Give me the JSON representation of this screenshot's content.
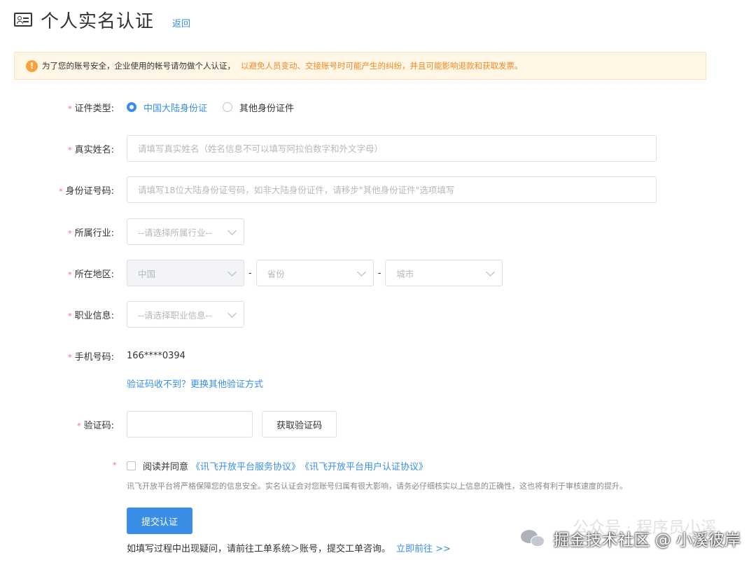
{
  "header": {
    "title": "个人实名认证",
    "back_label": "返回"
  },
  "alert": {
    "text_normal": "为了您的账号安全，企业使用的帐号请勿做个人认证，",
    "text_warning": "以避免人员变动、交接账号时可能产生的纠纷，并且可能影响退款和获取发票。"
  },
  "form": {
    "id_type": {
      "label": "证件类型:",
      "options": [
        "中国大陆身份证",
        "其他身份证件"
      ],
      "selected": "中国大陆身份证"
    },
    "real_name": {
      "label": "真实姓名:",
      "placeholder": "请填写真实姓名（姓名信息不可以填写阿拉伯数字和外文字母）"
    },
    "id_number": {
      "label": "身份证号码:",
      "placeholder": "请填写18位大陆身份证号码，如非大陆身份证件，请移步\"其他身份证件\"选项填写"
    },
    "industry": {
      "label": "所属行业:",
      "placeholder": "--请选择所属行业--"
    },
    "region": {
      "label": "所在地区:",
      "country": "中国",
      "province": "省份",
      "city": "城市",
      "separator": "-"
    },
    "occupation": {
      "label": "职业信息:",
      "placeholder": "--请选择职业信息--"
    },
    "phone": {
      "label": "手机号码:",
      "value": "166****0394",
      "alt_link": "验证码收不到？更换其他验证方式"
    },
    "code": {
      "label": "验证码:",
      "value": "",
      "button": "获取验证码"
    },
    "agreement": {
      "prefix": "阅读并同意",
      "link1": "《讯飞开放平台服务协议》",
      "link2": "《讯飞开放平台用户认证协议》",
      "note": "讯飞开放平台将严格保障您的信息安全。实名认证会对您账号归属有很大影响，请务必仔细核实以上信息的正确性，这也将有利于审核速度的提升。"
    },
    "submit_label": "提交认证"
  },
  "footer": {
    "text": "如填写过程中出现疑问，请前往工单系统＞账号，提交工单咨询。",
    "link": "立即前往 >>"
  },
  "watermark": {
    "faint": "公众号 · 程序员小溪",
    "text": "掘金技术社区 @ 小溪彼岸"
  },
  "required_mark": "*",
  "colors": {
    "primary": "#3a8ee6",
    "warning": "#f08a24",
    "required": "#f56c6c"
  }
}
